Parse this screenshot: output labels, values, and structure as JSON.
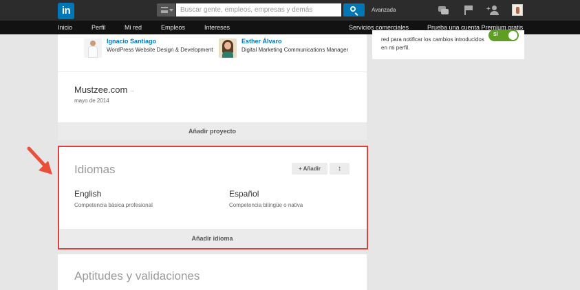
{
  "header": {
    "logo_text": "in",
    "search": {
      "placeholder": "Buscar gente, empleos, empresas y demás"
    },
    "advanced_label": "Avanzada",
    "brand_color": "#0077b5"
  },
  "nav": {
    "items": [
      {
        "label": "Inicio"
      },
      {
        "label": "Perfil"
      },
      {
        "label": "Mi red"
      },
      {
        "label": "Empleos"
      },
      {
        "label": "Intereses"
      },
      {
        "label": "Servicios comerciales"
      },
      {
        "label": "Prueba una cuenta Premium gratis"
      }
    ]
  },
  "people": [
    {
      "name": "Ignacio Santiago",
      "title": "WordPress Website Design & Development"
    },
    {
      "name": "Esther Álvaro",
      "title": "Digital Marketing Communications Manager"
    }
  ],
  "project": {
    "title": "Mustzee.com",
    "date": "mayo de 2014",
    "add_label": "Añadir proyecto"
  },
  "languages": {
    "title": "Idiomas",
    "add_button": "+ Añadir",
    "reorder_icon": "up-down-arrow",
    "items": [
      {
        "name": "English",
        "level": "Competencia básica profesional"
      },
      {
        "name": "Español",
        "level": "Competencia bilingüe o nativa"
      }
    ],
    "add_bar_label": "Añadir idioma",
    "highlight_color": "#d9433b"
  },
  "skills": {
    "title": "Aptitudes y validaciones"
  },
  "sidebar": {
    "notify_text": "red para notificar los cambios introducidos en mi perfil.",
    "toggle_label": "SÍ",
    "toggle_color": "#5e9e24"
  }
}
